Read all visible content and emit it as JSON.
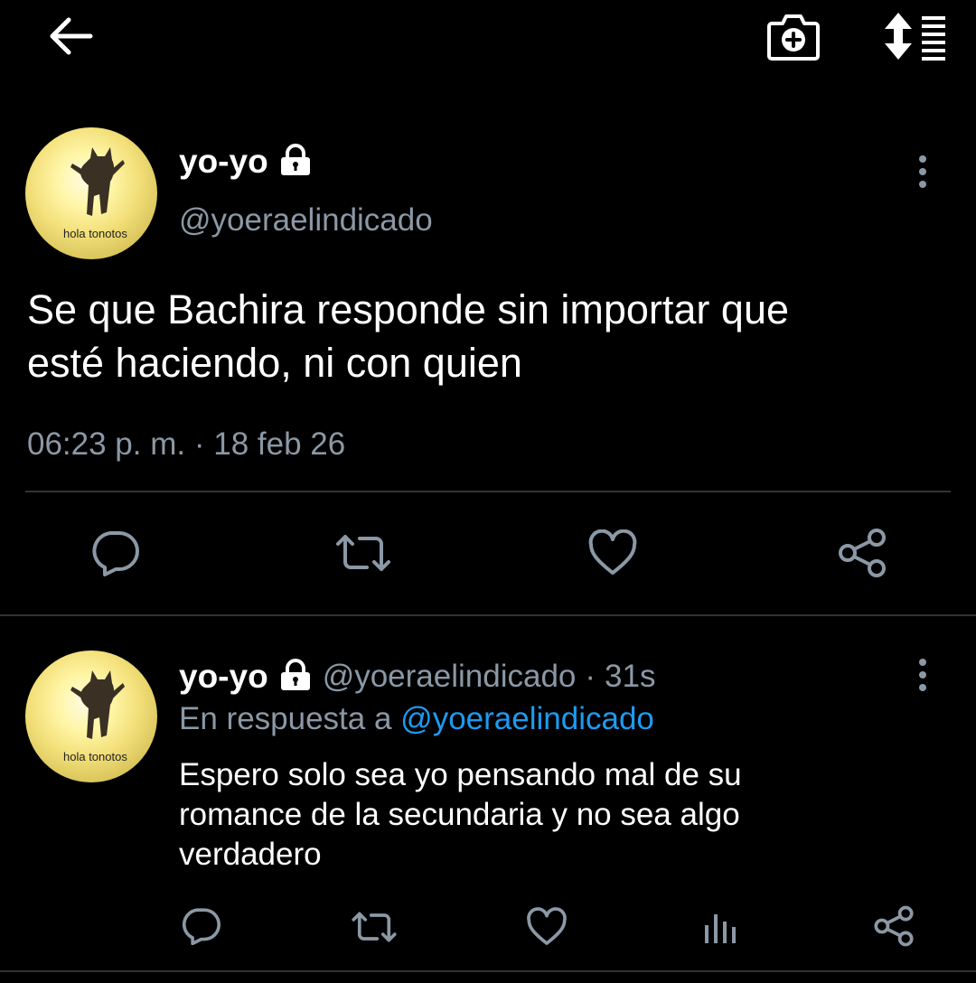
{
  "tweet": {
    "avatar_caption": "hola tonotos",
    "name": "yo-yo",
    "handle": "@yoeraelindicado",
    "text_line1": "Se que Bachira responde sin importar que",
    "text_line2": "esté haciendo, ni con quien",
    "time": "06:23 p. m.",
    "separator": "·",
    "date": "18 feb 26"
  },
  "reply": {
    "avatar_caption": "hola tonotos",
    "name": "yo-yo",
    "handle": "@yoeraelindicado",
    "separator": "·",
    "age": "31s",
    "reply_prefix": "En respuesta a",
    "reply_mention": "@yoeraelindicado",
    "text_line1": "Espero solo sea yo pensando mal de su",
    "text_line2": "romance de la secundaria y no sea algo",
    "text_line3": "verdadero"
  },
  "colors": {
    "background": "#000000",
    "secondary_text": "#8b98a5",
    "link": "#1d9bf0",
    "divider": "#2f3336"
  },
  "icons": [
    "back-arrow-icon",
    "camera-add-icon",
    "sort-icon",
    "lock-icon",
    "more-icon",
    "reply-icon",
    "retweet-icon",
    "like-icon",
    "share-icon",
    "analytics-icon"
  ]
}
